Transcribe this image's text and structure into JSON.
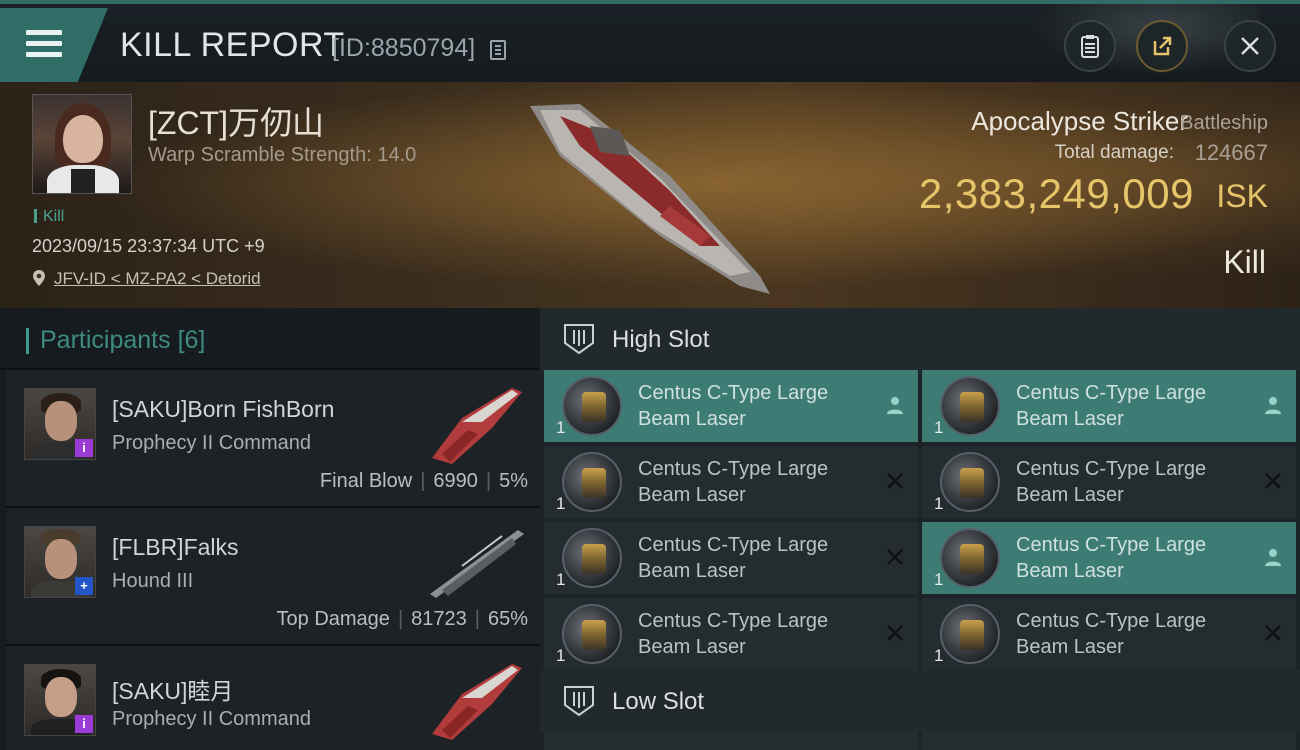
{
  "titlebar": {
    "title": "KILL REPORT",
    "report_id": "[ID:8850794]"
  },
  "victim": {
    "name": "[ZCT]万仞山",
    "warp_scramble": "Warp Scramble Strength: 14.0",
    "tag": "Kill",
    "timestamp": "2023/09/15 23:37:34 UTC +9",
    "location": "JFV-ID < MZ-PA2 < Detorid"
  },
  "ship": {
    "name": "Apocalypse Striker",
    "class": "Battleship",
    "total_damage_label": "Total damage:",
    "total_damage_value": "124667",
    "isk_value": "2,383,249,009",
    "isk_unit": "ISK",
    "result": "Kill"
  },
  "participants": {
    "title": "Participants",
    "count": "[6]",
    "items": [
      {
        "name": "[SAKU]Born FishBorn",
        "ship": "Prophecy II Command",
        "role": "Final Blow",
        "damage": "6990",
        "percent": "5%",
        "badge": "i"
      },
      {
        "name": "[FLBR]Falks",
        "ship": "Hound III",
        "role": "Top Damage",
        "damage": "81723",
        "percent": "65%",
        "badge": "+"
      },
      {
        "name": "[SAKU]睦月",
        "ship": "Prophecy II Command",
        "badge": "i"
      }
    ]
  },
  "fitting": {
    "high_slot_label": "High Slot",
    "low_slot_label": "Low Slot",
    "modules": [
      {
        "line1": "Centus C-Type Large",
        "line2": "Beam Laser",
        "qty": "1",
        "status": "person-icon"
      },
      {
        "line1": "Centus C-Type Large",
        "line2": "Beam Laser",
        "qty": "1",
        "status": "person-icon"
      },
      {
        "line1": "Centus C-Type Large",
        "line2": "Beam Laser",
        "qty": "1",
        "status": "x-icon"
      },
      {
        "line1": "Centus C-Type Large",
        "line2": "Beam Laser",
        "qty": "1",
        "status": "x-icon"
      },
      {
        "line1": "Centus C-Type Large",
        "line2": "Beam Laser",
        "qty": "1",
        "status": "x-icon"
      },
      {
        "line1": "Centus C-Type Large",
        "line2": "Beam Laser",
        "qty": "1",
        "status": "person-icon"
      },
      {
        "line1": "Centus C-Type Large",
        "line2": "Beam Laser",
        "qty": "1",
        "status": "x-icon"
      },
      {
        "line1": "Centus C-Type Large",
        "line2": "Beam Laser",
        "qty": "1",
        "status": "x-icon"
      }
    ]
  },
  "colors": {
    "accent_teal": "#3d7c74",
    "isk_gold": "#e6c46a",
    "badge_purple": "#9b3bd6",
    "badge_blue": "#2456c8"
  }
}
